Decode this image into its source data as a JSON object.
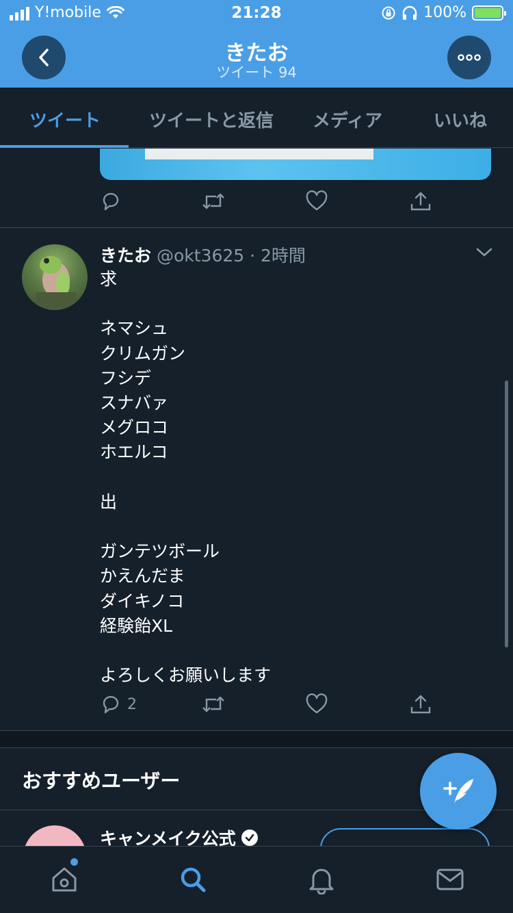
{
  "status_bar": {
    "carrier": "Y!mobile",
    "time": "21:28",
    "battery": "100%"
  },
  "header": {
    "title": "きたお",
    "subtitle": "ツイート 94",
    "back_icon": "chevron-left-icon",
    "more_icon": "more-icon",
    "bg_color": "#4a9ee6"
  },
  "tabs": [
    {
      "label": "ツイート",
      "active": true
    },
    {
      "label": "ツイートと返信",
      "active": false
    },
    {
      "label": "メディア",
      "active": false
    },
    {
      "label": "いいね",
      "active": false
    }
  ],
  "tweets": [
    {
      "partial": true,
      "reply_count": "",
      "icons": [
        "reply-icon",
        "retweet-icon",
        "like-icon",
        "share-icon"
      ]
    },
    {
      "name": "きたお",
      "handle": "@okt3625",
      "time": "2時間",
      "text": "求\n\nネマシュ\nクリムガン\nフシデ\nスナバァ\nメグロコ\nホエルコ\n\n出\n\nガンテツボール\nかえんだま\nダイキノコ\n経験飴XL\n\nよろしくお願いします",
      "reply_count": "2"
    }
  ],
  "recommended": {
    "title": "おすすめユーザー",
    "users": [
      {
        "name": "キャンメイク公式",
        "verified": true
      }
    ]
  },
  "fab": {
    "icon": "compose-tweet-icon"
  },
  "bottom_nav": [
    "home-icon",
    "search-icon",
    "notifications-icon",
    "messages-icon"
  ],
  "colors": {
    "background": "#15202b",
    "accent": "#4a9ee6",
    "muted": "#8899a6",
    "border": "#38444d"
  }
}
